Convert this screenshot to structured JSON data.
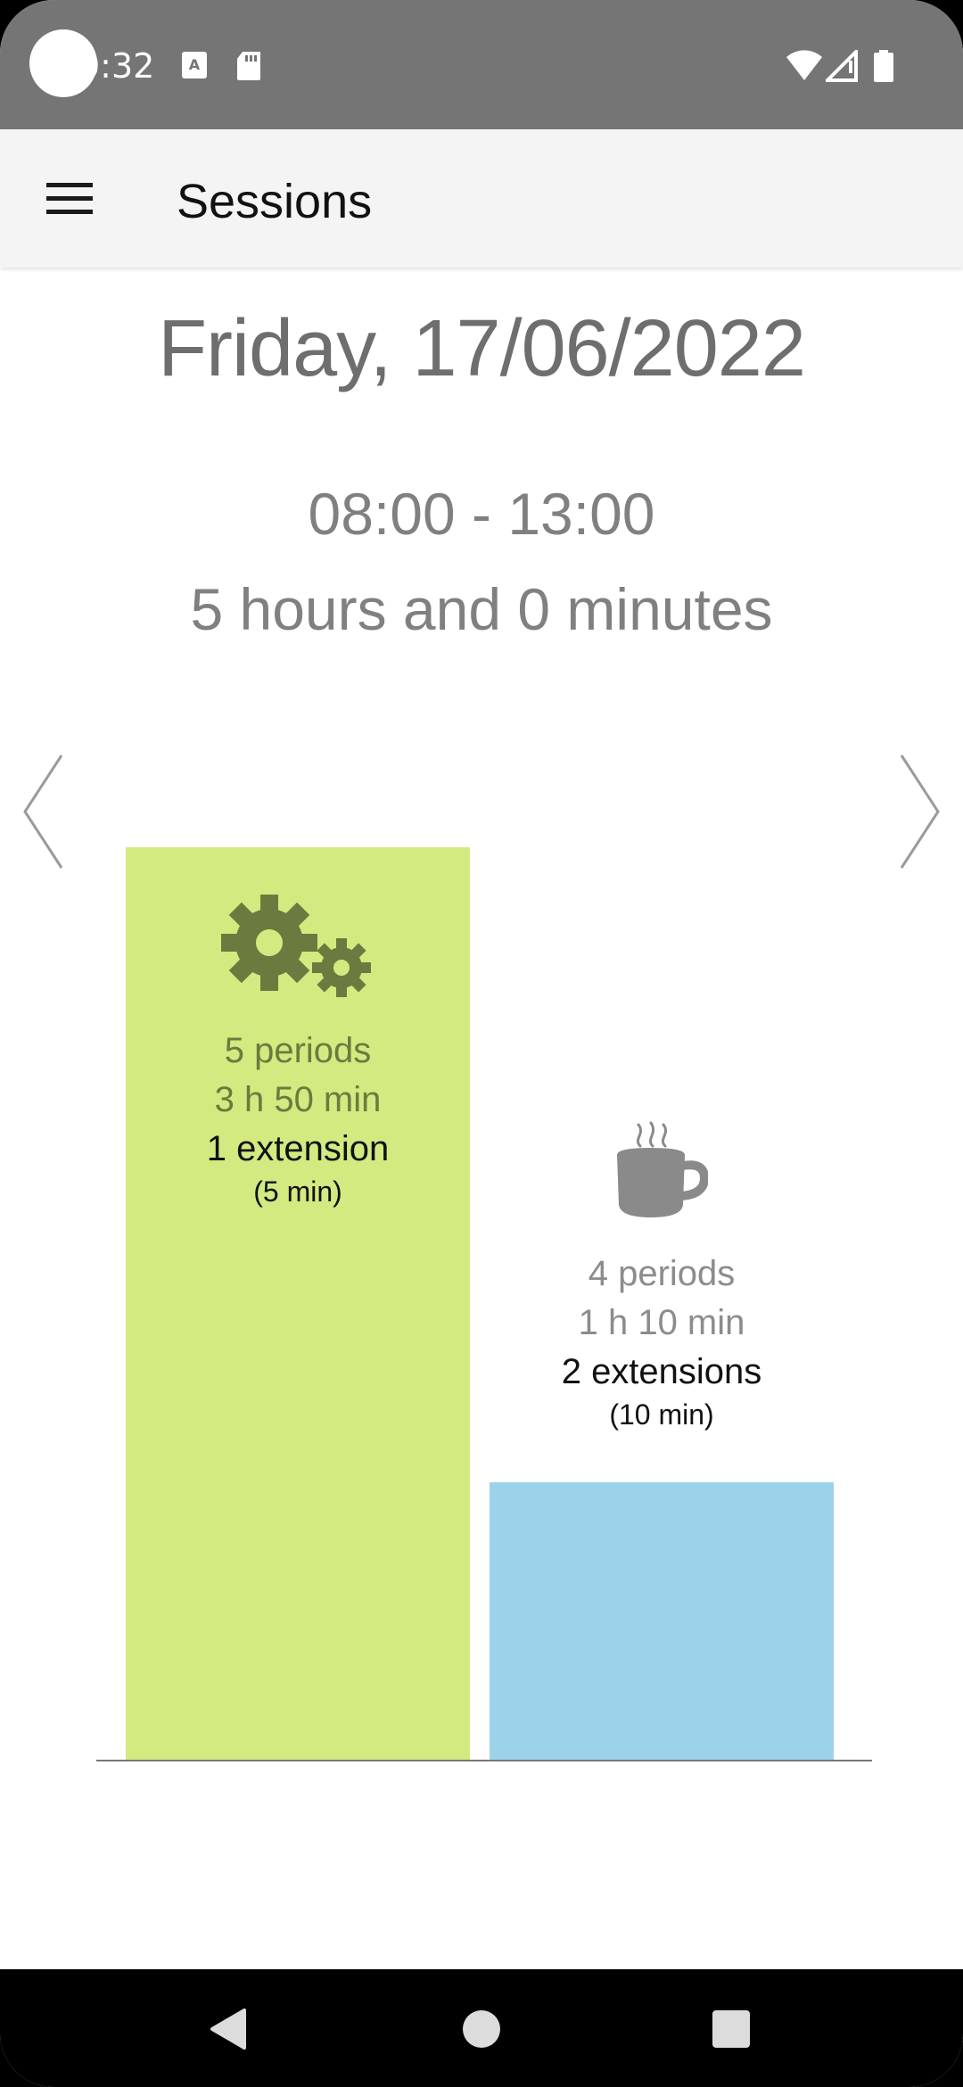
{
  "status_bar": {
    "time": "0:32",
    "icons": [
      "notification-a-icon",
      "sd-card-icon",
      "wifi-icon",
      "cell-signal-icon",
      "battery-icon"
    ]
  },
  "app_bar": {
    "title": "Sessions",
    "menu_icon": "hamburger-menu-icon"
  },
  "summary": {
    "date": "Friday, 17/06/2022",
    "time_range": "08:00 - 13:00",
    "duration": "5 hours and 0 minutes"
  },
  "chart_data": {
    "type": "bar",
    "categories": [
      "Work",
      "Break"
    ],
    "values_minutes": [
      230,
      70
    ],
    "colors": [
      "#d3ea80",
      "#9dd3ea"
    ],
    "bars": [
      {
        "icon": "gears-icon",
        "periods": "5 periods",
        "duration": "3 h 50 min",
        "extensions": "1 extension",
        "extension_time": "(5 min)"
      },
      {
        "icon": "coffee-cup-icon",
        "periods": "4 periods",
        "duration": "1 h 10 min",
        "extensions": "2 extensions",
        "extension_time": "(10 min)"
      }
    ]
  },
  "navigation": {
    "prev_icon": "chevron-left-icon",
    "next_icon": "chevron-right-icon",
    "system": [
      "back-icon",
      "home-icon",
      "recents-icon"
    ]
  }
}
